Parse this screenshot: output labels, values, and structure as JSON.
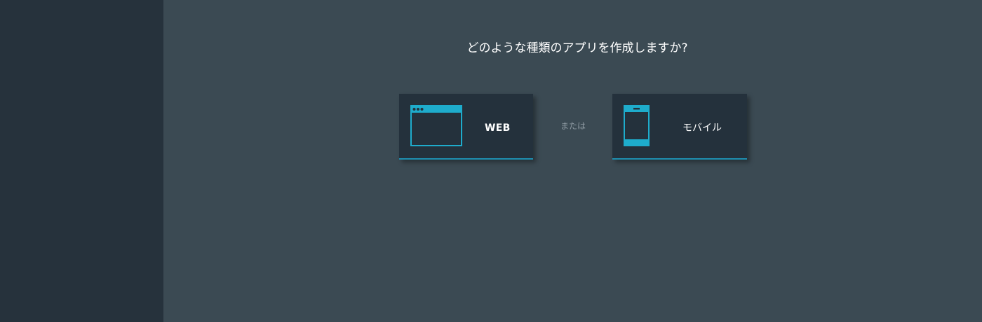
{
  "prompt": {
    "title": "どのような種類のアプリを作成しますか?"
  },
  "options": {
    "web": {
      "label": "WEB",
      "icon": "browser-window-icon"
    },
    "separator": "または",
    "mobile": {
      "label": "モバイル",
      "icon": "mobile-phone-icon"
    }
  },
  "colors": {
    "sidebar": "#26323c",
    "main_bg": "#3b4a53",
    "card_bg": "#24313c",
    "accent": "#1eaccc"
  }
}
